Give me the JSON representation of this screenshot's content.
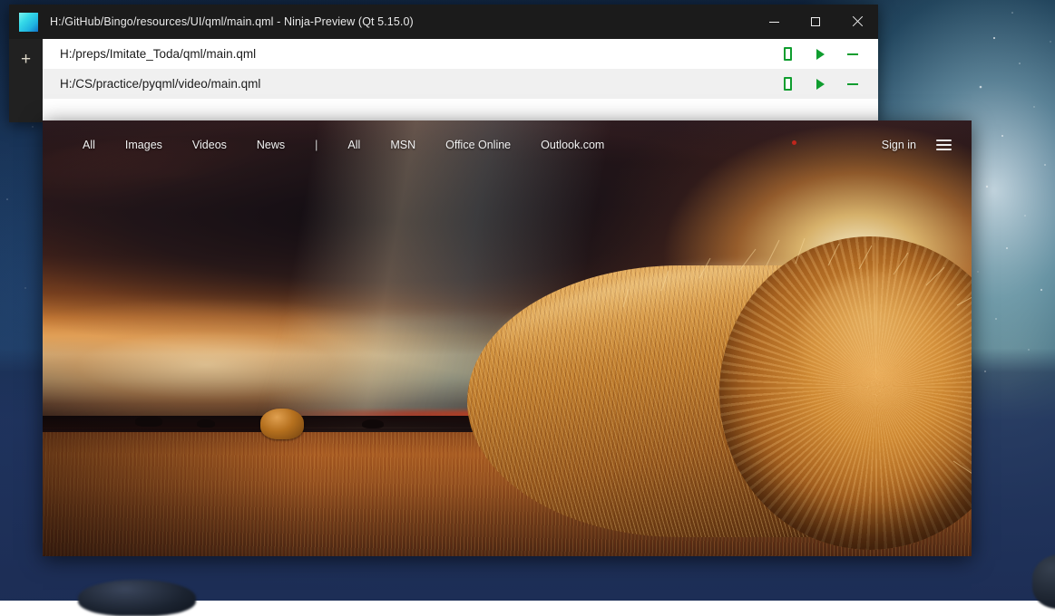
{
  "window": {
    "title": "H:/GitHub/Bingo/resources/UI/qml/main.qml  -  Ninja-Preview (Qt 5.15.0)",
    "app_icon": "ninja-preview-icon",
    "controls": {
      "minimize_label": "–",
      "maximize_label": "□",
      "close_label": "✕"
    },
    "sidebar": {
      "add_label": "+"
    },
    "accent_green": "#0f9d2f",
    "titlebar_color": "#1b1b1b"
  },
  "file_list": {
    "rows": [
      {
        "path": "H:/preps/Imitate_Toda/qml/main.qml",
        "device_icon": "device-icon",
        "run_icon": "play-icon",
        "remove_icon": "minus-icon"
      },
      {
        "path": "H:/CS/practice/pyqml/video/main.qml",
        "device_icon": "device-icon",
        "run_icon": "play-icon",
        "remove_icon": "minus-icon"
      }
    ]
  },
  "preview": {
    "nav_left": [
      {
        "label": "All"
      },
      {
        "label": "Images"
      },
      {
        "label": "Videos"
      },
      {
        "label": "News"
      }
    ],
    "separator": "|",
    "nav_right": [
      {
        "label": "All"
      },
      {
        "label": "MSN"
      },
      {
        "label": "Office Online"
      },
      {
        "label": "Outlook.com"
      }
    ],
    "sign_in_label": "Sign in",
    "menu_icon": "hamburger-menu-icon",
    "notification_dot": "red-dot-indicator",
    "background_description": "sunset-hay-bale-field-photo"
  },
  "desktop": {
    "wallpaper_description": "milky-way-night-sky-over-water-wallpaper"
  }
}
